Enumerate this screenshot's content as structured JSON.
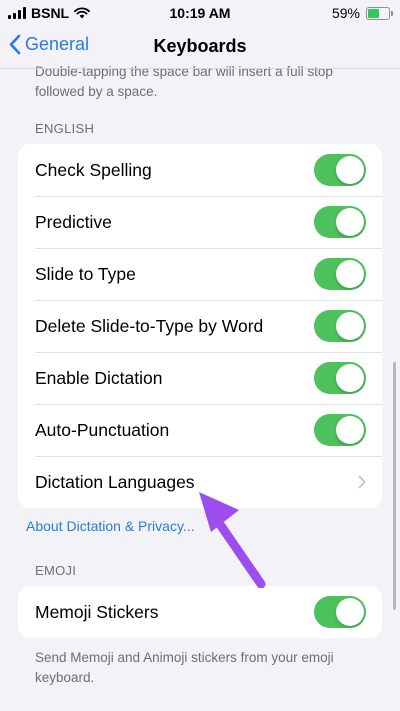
{
  "status_bar": {
    "carrier": "BSNL",
    "time": "10:19 AM",
    "battery_percent": "59%",
    "battery_level": 0.59
  },
  "nav": {
    "back_label": "General",
    "title": "Keyboards"
  },
  "top_footer": "Double-tapping the space bar will insert a full stop followed by a space.",
  "english": {
    "header": "ENGLISH",
    "rows": [
      {
        "label": "Check Spelling",
        "on": true
      },
      {
        "label": "Predictive",
        "on": true
      },
      {
        "label": "Slide to Type",
        "on": true
      },
      {
        "label": "Delete Slide-to-Type by Word",
        "on": true
      },
      {
        "label": "Enable Dictation",
        "on": true
      },
      {
        "label": "Auto-Punctuation",
        "on": true
      },
      {
        "label": "Dictation Languages"
      }
    ]
  },
  "about_link": "About Dictation & Privacy...",
  "emoji": {
    "header": "EMOJI",
    "rows": [
      {
        "label": "Memoji Stickers",
        "on": true
      }
    ],
    "footer": "Send Memoji and Animoji stickers from your emoji keyboard."
  },
  "colors": {
    "toggle_on": "#4cc15c",
    "link": "#2a7ae2",
    "annotation_arrow": "#9b4dee"
  },
  "icons": [
    "signal-icon",
    "wifi-icon",
    "battery-icon",
    "back-chevron-icon",
    "disclosure-chevron-icon",
    "annotation-arrow"
  ]
}
